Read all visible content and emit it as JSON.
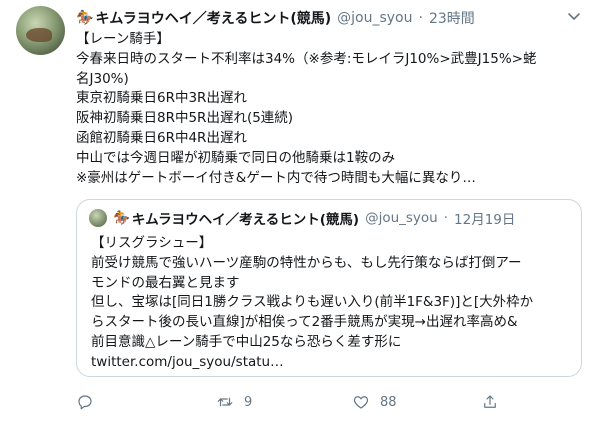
{
  "tweet": {
    "display_name": "キムラヨウヘイ／考えるヒント(競馬)",
    "handle": "@jou_syou",
    "time": "23時間",
    "body_lines": [
      "【レーン騎手】",
      "今春来日時のスタート不利率は34%（※参考:モレイラJ10%>武豊J15%>蛯",
      "名J30%)",
      "東京初騎乗日6R中3R出遅れ",
      "阪神初騎乗日8R中5R出遅れ(5連続)",
      "函館初騎乗日6R中4R出遅れ",
      "中山では今週日曜が初騎乗で同日の他騎乗は1鞍のみ",
      "※豪州はゲートボーイ付き&ゲート内で待つ時間も大幅に異なり…"
    ]
  },
  "quote": {
    "display_name": "キムラヨウヘイ／考えるヒント(競馬)",
    "handle": "@jou_syou",
    "date": "12月19日",
    "body_lines": [
      "【リスグラシュー】",
      "前受け競馬で強いハーツ産駒の特性からも、もし先行策ならば打倒アー",
      "モンドの最右翼と見ます",
      "但し、宝塚は[同日1勝クラス戦よりも遅い入り(前半1F&3F)]と[大外枠か",
      "らスタート後の長い直線]が相俟って2番手競馬が実現→出遅れ率高め&",
      "前目意識△レーン騎手で中山25なら恐らく差す形に",
      "twitter.com/jou_syou/statu…"
    ]
  },
  "actions": {
    "reply_count": "",
    "retweet_count": "9",
    "like_count": "88"
  },
  "icons": {
    "caret": "chevron-down-icon",
    "reply": "reply-icon",
    "retweet": "retweet-icon",
    "like": "heart-icon",
    "share": "share-icon",
    "horse": "horse-icon"
  },
  "colors": {
    "text": "#14171a",
    "secondary": "#657786",
    "border": "#ccd6dd"
  }
}
